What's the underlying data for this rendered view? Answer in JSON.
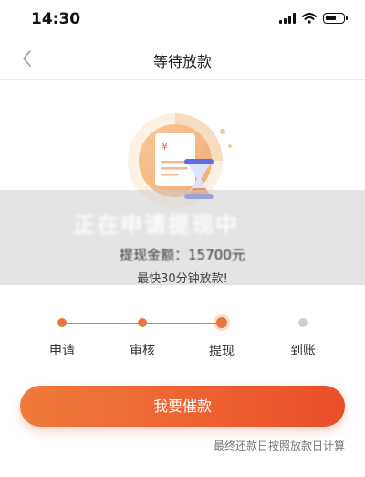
{
  "status_bar": {
    "time": "14:30"
  },
  "nav": {
    "title": "等待放款"
  },
  "banner": {
    "heading": "正在申请提现中",
    "amount_line": "提现金额：15700元",
    "speed_note": "最快30分钟放款!"
  },
  "progress": {
    "steps": [
      {
        "label": "申请",
        "state": "done"
      },
      {
        "label": "审核",
        "state": "done"
      },
      {
        "label": "提现",
        "state": "current"
      },
      {
        "label": "到账",
        "state": "todo"
      }
    ]
  },
  "illustration": {
    "currency_symbol": "¥"
  },
  "action": {
    "urge_label": "我要催款"
  },
  "footer": {
    "note": "最终还款日按照放款日计算"
  },
  "colors": {
    "accent": "#ea4e2a",
    "accent_light": "#f07a3c",
    "pending": "#cfcfcf"
  }
}
